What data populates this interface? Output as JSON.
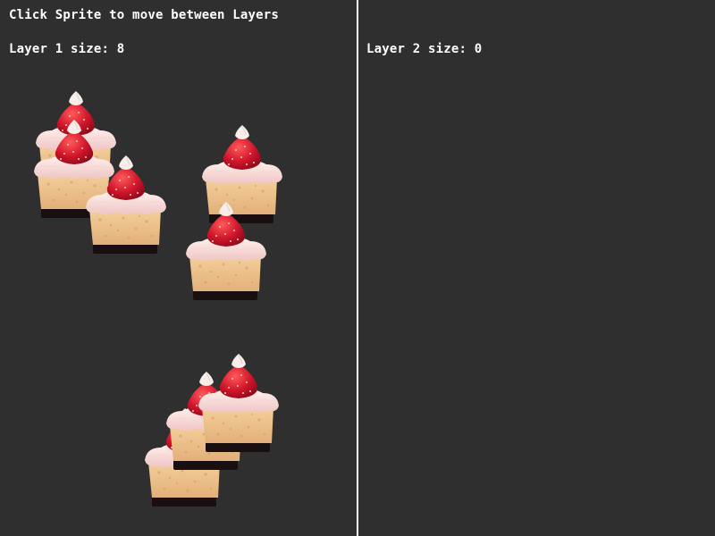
{
  "instruction": "Click Sprite to move between Layers",
  "layer1": {
    "label": "Layer 1 size: 8",
    "sprites": [
      {
        "name": "cake-sprite-1",
        "icon": "strawberry-cake-icon"
      },
      {
        "name": "cake-sprite-2",
        "icon": "strawberry-cake-icon"
      },
      {
        "name": "cake-sprite-3",
        "icon": "strawberry-cake-icon"
      },
      {
        "name": "cake-sprite-4",
        "icon": "strawberry-cake-icon"
      },
      {
        "name": "cake-sprite-5",
        "icon": "strawberry-cake-icon"
      },
      {
        "name": "cake-sprite-6",
        "icon": "strawberry-cake-icon"
      },
      {
        "name": "cake-sprite-7",
        "icon": "strawberry-cake-icon"
      },
      {
        "name": "cake-sprite-8",
        "icon": "strawberry-cake-icon"
      }
    ]
  },
  "layer2": {
    "label": "Layer 2 size: 0",
    "sprites": []
  },
  "colors": {
    "background": "#2f2f2f",
    "divider": "#ffffff",
    "text": "#ffffff"
  }
}
